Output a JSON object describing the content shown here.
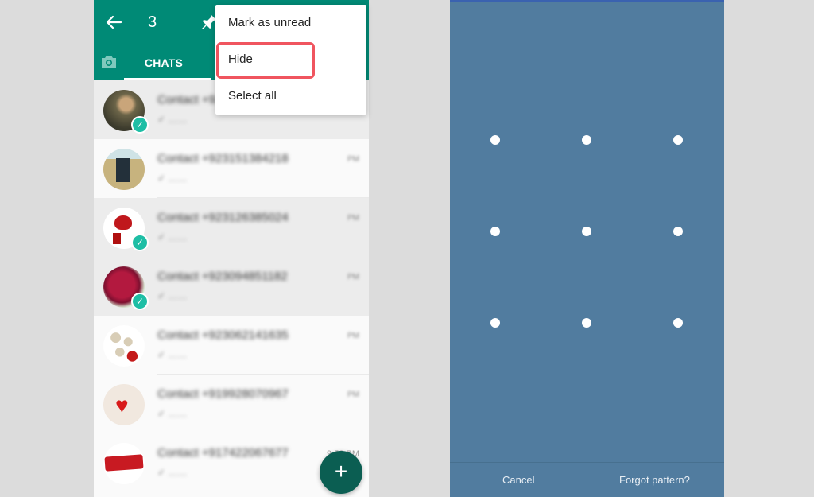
{
  "left_screen": {
    "appbar": {
      "back_icon": "arrow-left",
      "selected_count": "3",
      "pin_icon": "pin"
    },
    "tabs": {
      "camera_icon": "camera",
      "chats_label": "CHATS"
    },
    "overflow_menu": {
      "items": [
        {
          "label": "Mark as unread"
        },
        {
          "label": "Hide",
          "highlighted": true
        },
        {
          "label": "Select all"
        }
      ]
    },
    "chats": [
      {
        "name": "Contact +923…",
        "message": "✓ ……",
        "time": "",
        "selected": true,
        "avatar": "soldier-salute"
      },
      {
        "name": "Contact +923151384218",
        "message": "✓ ……",
        "time": "PM",
        "selected": false,
        "avatar": "chair-field"
      },
      {
        "name": "Contact +923126385024",
        "message": "✓ ……",
        "time": "PM",
        "selected": true,
        "avatar": "ishq-heart"
      },
      {
        "name": "Contact +923094851182",
        "message": "✓ ……",
        "time": "PM",
        "selected": true,
        "avatar": "red-rose"
      },
      {
        "name": "Contact +923062141635",
        "message": "✓ ……",
        "time": "PM",
        "selected": false,
        "avatar": "hearts-collage"
      },
      {
        "name": "Contact +919928070967",
        "message": "✓ ……",
        "time": "PM",
        "selected": false,
        "avatar": "red-heart"
      },
      {
        "name": "Contact +917422067677",
        "message": "✓ ……",
        "time": "9:52 PM",
        "selected": false,
        "avatar": "red-text-logo"
      }
    ],
    "fab": {
      "icon": "plus"
    }
  },
  "right_screen": {
    "pattern_grid": {
      "rows": 3,
      "cols": 3
    },
    "buttons": {
      "cancel": "Cancel",
      "forgot": "Forgot pattern?"
    }
  },
  "colors": {
    "whatsapp_green": "#008a76",
    "fab_green": "#0b5e52",
    "check_teal": "#1ebea5",
    "highlight_red": "#f0555f",
    "lock_background": "#517c9f"
  }
}
